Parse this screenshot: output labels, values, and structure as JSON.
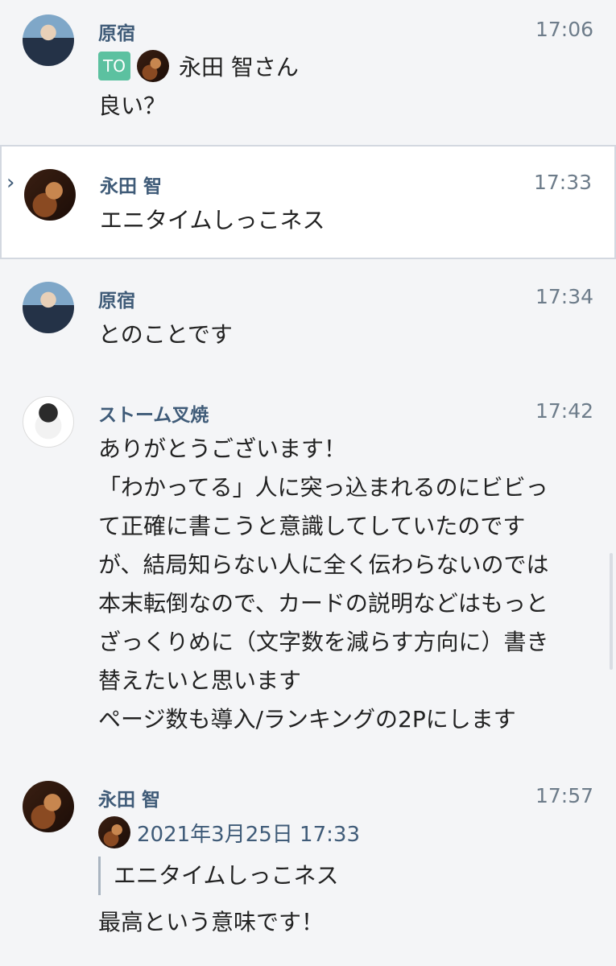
{
  "messages": [
    {
      "name": "原宿",
      "time": "17:06",
      "to_badge": "TO",
      "to_name": "永田 智さん",
      "text": "良い？"
    },
    {
      "name": "永田 智",
      "time": "17:33",
      "text": "エニタイムしっこネス"
    },
    {
      "name": "原宿",
      "time": "17:34",
      "text": "とのことです"
    },
    {
      "name": "ストーム叉焼",
      "time": "17:42",
      "lines": [
        "ありがとうございます！",
        "「わかってる」人に突っ込まれるのにビビっ",
        "て正確に書こうと意識してしていたのです",
        "が、結局知らない人に全く伝わらないのでは",
        "本末転倒なので、カードの説明などはもっと",
        "ざっくりめに（文字数を減らす方向に）書き",
        "替えたいと思います",
        "ページ数も導入/ランキングの2Pにします"
      ]
    },
    {
      "name": "永田 智",
      "time": "17:57",
      "quote_date": "2021年3月25日 17:33",
      "quote_text": "エニタイムしっこネス",
      "text": "最高という意味です！"
    }
  ]
}
